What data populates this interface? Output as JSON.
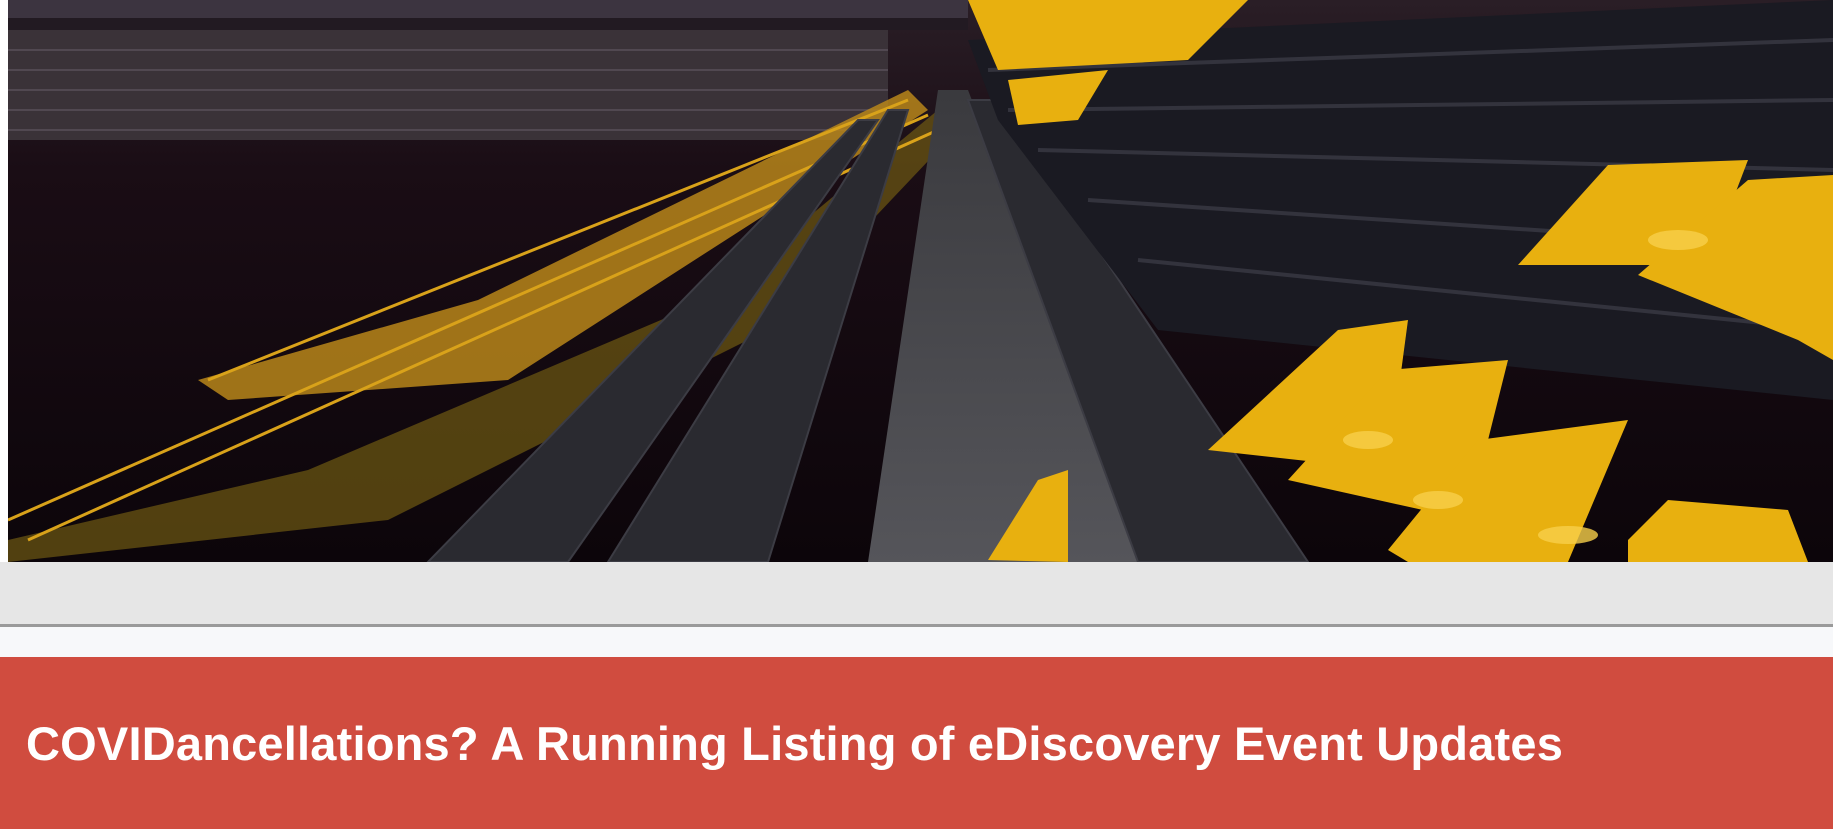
{
  "hero": {
    "description_icon": "stadium-seats-image",
    "colors": {
      "seat_yellow": "#e8b00f",
      "seat_dark": "#2a2a30",
      "background": "#140a12"
    }
  },
  "post": {
    "title": "COVIDancellations? A Running Listing of eDiscovery Event Updates",
    "title_bar_color": "#d04c3f",
    "title_text_color": "#ffffff"
  }
}
